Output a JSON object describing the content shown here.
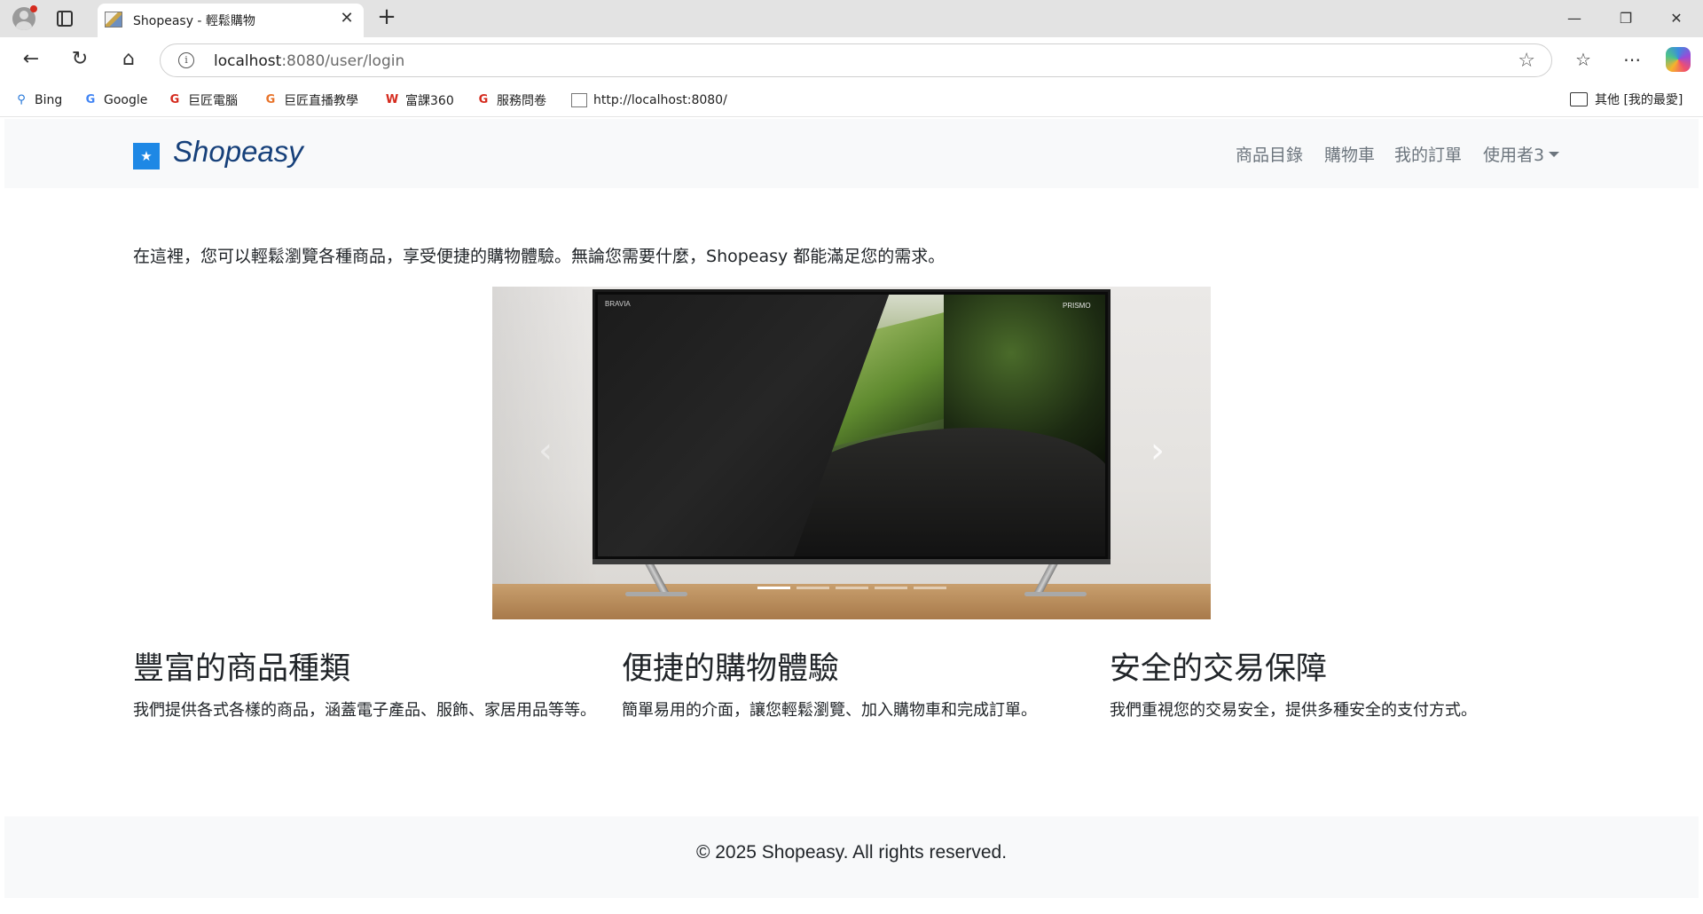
{
  "browser": {
    "tab_title": "Shopeasy - 輕鬆購物",
    "tab_close": "✕",
    "new_tab": "+",
    "url_host": "localhost",
    "url_rest": ":8080/user/login",
    "window_controls": {
      "minimize": "—",
      "restore": "❐",
      "close": "✕"
    },
    "bookmarks": [
      {
        "label": "Bing",
        "icon": "bing-icon",
        "color": "#1e73d8"
      },
      {
        "label": "Google",
        "icon": "google-icon",
        "color": "#4285f4"
      },
      {
        "label": "巨匠電腦",
        "icon": "gjun-icon",
        "color": "#d52b1e"
      },
      {
        "label": "巨匠直播教學",
        "icon": "gjun-live-icon",
        "color": "#e8732a"
      },
      {
        "label": "富課360",
        "icon": "fuke-icon",
        "color": "#d52b1e"
      },
      {
        "label": "服務問卷",
        "icon": "survey-icon",
        "color": "#d52b1e"
      },
      {
        "label": "http://localhost:8080/",
        "icon": "page-icon",
        "color": "#555555"
      }
    ],
    "other_favorites": "其他 [我的最愛]"
  },
  "site": {
    "brand": "Shopeasy",
    "nav": {
      "catalog": "商品目錄",
      "cart": "購物車",
      "orders": "我的訂單",
      "user": "使用者3"
    },
    "intro": "在這裡，您可以輕鬆瀏覽各種商品，享受便捷的購物體驗。無論您需要什麼，Shopeasy 都能滿足您的需求。",
    "carousel": {
      "prev": "‹",
      "next": "›",
      "slide_count": 5,
      "active_index": 0,
      "tv_brand": "BRAVIA",
      "tv_logo": "PRISMO"
    },
    "features": [
      {
        "title": "豐富的商品種類",
        "text": "我們提供各式各樣的商品，涵蓋電子產品、服飾、家居用品等等。"
      },
      {
        "title": "便捷的購物體驗",
        "text": "簡單易用的介面，讓您輕鬆瀏覽、加入購物車和完成訂單。"
      },
      {
        "title": "安全的交易保障",
        "text": "我們重視您的交易安全，提供多種安全的支付方式。"
      }
    ],
    "footer": "© 2025 Shopeasy. All rights reserved."
  },
  "colors": {
    "brand_text": "#16407a",
    "brand_logo": "#1e88e5",
    "nav_link": "#6c757d",
    "nav_bg": "#f8f9fa"
  }
}
